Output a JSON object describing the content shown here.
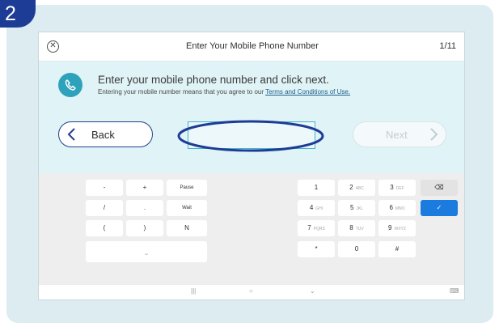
{
  "step_badge": "2",
  "title_bar": {
    "close_icon": "close-circle-icon",
    "title": "Enter Your Mobile Phone Number",
    "page_counter": "1/11"
  },
  "instructions": {
    "icon": "phone-handset-icon",
    "heading": "Enter your mobile phone number and click next.",
    "subtext_prefix": "Entering your mobile number means that you agree to our ",
    "terms_link": "Terms and Conditions of Use."
  },
  "actions": {
    "back_label": "Back",
    "next_label": "Next",
    "phone_input_value": ""
  },
  "colors": {
    "badge_blue": "#1d3c95",
    "accent_teal": "#2ea2bb",
    "highlight_ring": "#1d3c95",
    "enter_key_blue": "#1c7bdf",
    "panel_bg": "#dcecf1"
  },
  "keyboard": {
    "left_keys": [
      {
        "label": "-"
      },
      {
        "label": "+"
      },
      {
        "label": "Pause"
      },
      {
        "label": "/"
      },
      {
        "label": "."
      },
      {
        "label": "Wait"
      },
      {
        "label": "("
      },
      {
        "label": ")"
      },
      {
        "label": "N"
      }
    ],
    "space_key": "⎵",
    "number_keys": [
      {
        "num": "1",
        "letters": ""
      },
      {
        "num": "2",
        "letters": "ABC"
      },
      {
        "num": "3",
        "letters": "DEF"
      },
      {
        "num": "4",
        "letters": "GHI"
      },
      {
        "num": "5",
        "letters": "JKL"
      },
      {
        "num": "6",
        "letters": "MNO"
      },
      {
        "num": "7",
        "letters": "PQRS"
      },
      {
        "num": "8",
        "letters": "TUV"
      },
      {
        "num": "9",
        "letters": "WXYZ"
      },
      {
        "num": "*",
        "letters": ""
      },
      {
        "num": "0",
        "letters": ""
      },
      {
        "num": "#",
        "letters": ""
      }
    ],
    "backspace_icon": "backspace-icon",
    "enter_icon": "checkmark-icon",
    "backspace_glyph": "⌫",
    "enter_glyph": "✓"
  },
  "nav_bar": {
    "recents": "|||",
    "home": "○",
    "back": "⌄",
    "keyboard_switch": "⌨"
  }
}
